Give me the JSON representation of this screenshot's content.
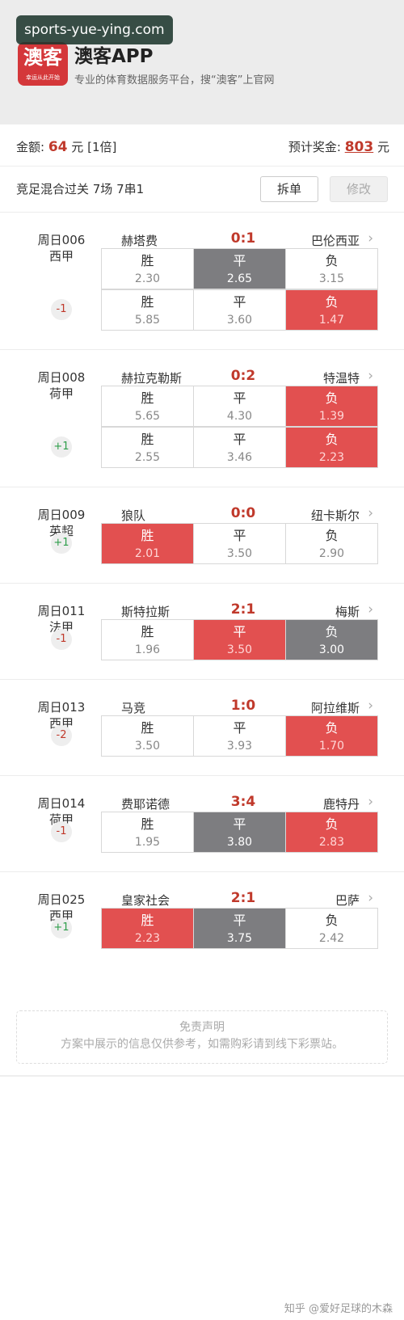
{
  "watermark": "sports-yue-ying.com",
  "app": {
    "logo_text": "澳客",
    "logo_sub": "幸运从此开始",
    "name": "澳客APP",
    "tagline": "专业的体育数据服务平台，搜“澳客”上官网"
  },
  "summary": {
    "amount_label": "金额:",
    "amount_value": "64",
    "amount_unit": "元",
    "multiplier": "[1倍]",
    "prize_label": "预计奖金:",
    "prize_value": "803",
    "prize_unit": "元"
  },
  "plan": {
    "label": "竞足混合过关 7场 7串1",
    "split_button": "拆单",
    "edit_button": "修改"
  },
  "matches": [
    {
      "id": "周日006",
      "league": "西甲",
      "home": "赫塔费",
      "score": "0:1",
      "away": "巴伦西亚",
      "rows": [
        {
          "handicap": "",
          "cells": [
            {
              "label": "胜",
              "odds": "2.30",
              "state": "none"
            },
            {
              "label": "平",
              "odds": "2.65",
              "state": "gray"
            },
            {
              "label": "负",
              "odds": "3.15",
              "state": "none"
            }
          ]
        },
        {
          "handicap": "-1",
          "cells": [
            {
              "label": "胜",
              "odds": "5.85",
              "state": "none"
            },
            {
              "label": "平",
              "odds": "3.60",
              "state": "none"
            },
            {
              "label": "负",
              "odds": "1.47",
              "state": "red"
            }
          ]
        }
      ]
    },
    {
      "id": "周日008",
      "league": "荷甲",
      "home": "赫拉克勒斯",
      "score": "0:2",
      "away": "特温特",
      "rows": [
        {
          "handicap": "",
          "cells": [
            {
              "label": "胜",
              "odds": "5.65",
              "state": "none"
            },
            {
              "label": "平",
              "odds": "4.30",
              "state": "none"
            },
            {
              "label": "负",
              "odds": "1.39",
              "state": "red"
            }
          ]
        },
        {
          "handicap": "+1",
          "cells": [
            {
              "label": "胜",
              "odds": "2.55",
              "state": "none"
            },
            {
              "label": "平",
              "odds": "3.46",
              "state": "none"
            },
            {
              "label": "负",
              "odds": "2.23",
              "state": "red"
            }
          ]
        }
      ]
    },
    {
      "id": "周日009",
      "league": "英超",
      "home": "狼队",
      "score": "0:0",
      "away": "纽卡斯尔",
      "rows": [
        {
          "handicap": "+1",
          "cells": [
            {
              "label": "胜",
              "odds": "2.01",
              "state": "red"
            },
            {
              "label": "平",
              "odds": "3.50",
              "state": "none"
            },
            {
              "label": "负",
              "odds": "2.90",
              "state": "none"
            }
          ]
        }
      ]
    },
    {
      "id": "周日011",
      "league": "法甲",
      "home": "斯特拉斯",
      "score": "2:1",
      "away": "梅斯",
      "rows": [
        {
          "handicap": "-1",
          "cells": [
            {
              "label": "胜",
              "odds": "1.96",
              "state": "none"
            },
            {
              "label": "平",
              "odds": "3.50",
              "state": "red"
            },
            {
              "label": "负",
              "odds": "3.00",
              "state": "gray"
            }
          ]
        }
      ]
    },
    {
      "id": "周日013",
      "league": "西甲",
      "home": "马竞",
      "score": "1:0",
      "away": "阿拉维斯",
      "rows": [
        {
          "handicap": "-2",
          "cells": [
            {
              "label": "胜",
              "odds": "3.50",
              "state": "none"
            },
            {
              "label": "平",
              "odds": "3.93",
              "state": "none"
            },
            {
              "label": "负",
              "odds": "1.70",
              "state": "red"
            }
          ]
        }
      ]
    },
    {
      "id": "周日014",
      "league": "荷甲",
      "home": "费耶诺德",
      "score": "3:4",
      "away": "鹿特丹",
      "rows": [
        {
          "handicap": "-1",
          "cells": [
            {
              "label": "胜",
              "odds": "1.95",
              "state": "none"
            },
            {
              "label": "平",
              "odds": "3.80",
              "state": "gray"
            },
            {
              "label": "负",
              "odds": "2.83",
              "state": "red"
            }
          ]
        }
      ]
    },
    {
      "id": "周日025",
      "league": "西甲",
      "home": "皇家社会",
      "score": "2:1",
      "away": "巴萨",
      "rows": [
        {
          "handicap": "+1",
          "cells": [
            {
              "label": "胜",
              "odds": "2.23",
              "state": "red"
            },
            {
              "label": "平",
              "odds": "3.75",
              "state": "gray"
            },
            {
              "label": "负",
              "odds": "2.42",
              "state": "none"
            }
          ]
        }
      ]
    }
  ],
  "disclaimer": {
    "title": "免责声明",
    "text": "方案中展示的信息仅供参考，如需购彩请到线下彩票站。"
  },
  "footer": "知乎 @爱好足球的木森"
}
